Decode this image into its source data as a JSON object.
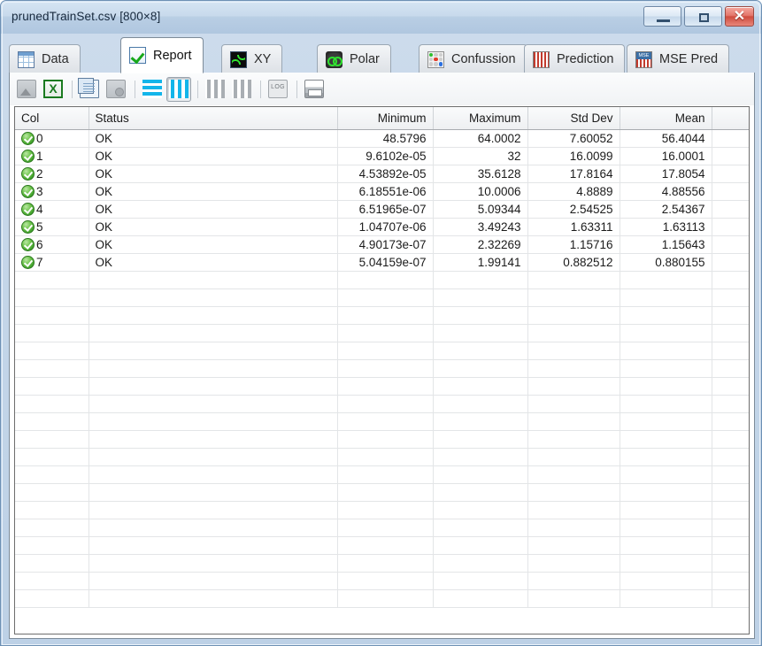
{
  "window": {
    "title": "prunedTrainSet.csv [800×8]",
    "controls": {
      "minimize": "Minimize",
      "maximize": "Maximize",
      "close": "✕"
    }
  },
  "tabs": [
    {
      "label": "Data",
      "icon": "table-grid-icon",
      "active": false
    },
    {
      "label": "Report",
      "icon": "checkbox-check-icon",
      "active": true
    },
    {
      "label": "XY",
      "icon": "sine-wave-icon",
      "active": false
    },
    {
      "label": "Polar",
      "icon": "polar-plot-icon",
      "active": false
    },
    {
      "label": "Confussion",
      "icon": "confusion-matrix-icon",
      "active": false
    },
    {
      "label": "Prediction",
      "icon": "prediction-grid-icon",
      "active": false
    },
    {
      "label": "MSE Pred",
      "icon": "mse-grid-icon",
      "active": false
    }
  ],
  "toolbar": {
    "buttons": [
      {
        "name": "save-image-button",
        "icon": "image-icon",
        "state": "disabled"
      },
      {
        "name": "export-excel-button",
        "icon": "excel-icon",
        "state": "enabled"
      },
      {
        "name": "copy-button",
        "icon": "copy-icon",
        "state": "enabled"
      },
      {
        "name": "paste-add-button",
        "icon": "paste-add-icon",
        "state": "disabled"
      },
      {
        "name": "horizontal-bars-button",
        "icon": "horizontal-bars-icon",
        "state": "enabled"
      },
      {
        "name": "vertical-bars-button",
        "icon": "vertical-bars-icon",
        "state": "pressed"
      },
      {
        "name": "gray-bars-1-button",
        "icon": "bars-icon",
        "state": "disabled"
      },
      {
        "name": "gray-bars-2-button",
        "icon": "bars-icon",
        "state": "disabled"
      },
      {
        "name": "log-scale-button",
        "icon": "log-icon",
        "state": "disabled"
      },
      {
        "name": "print-button",
        "icon": "printer-icon",
        "state": "enabled"
      }
    ]
  },
  "table": {
    "columns": [
      {
        "key": "col",
        "label": "Col",
        "align": "left"
      },
      {
        "key": "status",
        "label": "Status",
        "align": "left"
      },
      {
        "key": "minimum",
        "label": "Minimum",
        "align": "right"
      },
      {
        "key": "maximum",
        "label": "Maximum",
        "align": "right"
      },
      {
        "key": "stddev",
        "label": "Std Dev",
        "align": "right"
      },
      {
        "key": "mean",
        "label": "Mean",
        "align": "right"
      }
    ],
    "rows": [
      {
        "col": "0",
        "status": "OK",
        "minimum": "48.5796",
        "maximum": "64.0002",
        "stddev": "7.60052",
        "mean": "56.4044"
      },
      {
        "col": "1",
        "status": "OK",
        "minimum": "9.6102e-05",
        "maximum": "32",
        "stddev": "16.0099",
        "mean": "16.0001"
      },
      {
        "col": "2",
        "status": "OK",
        "minimum": "4.53892e-05",
        "maximum": "35.6128",
        "stddev": "17.8164",
        "mean": "17.8054"
      },
      {
        "col": "3",
        "status": "OK",
        "minimum": "6.18551e-06",
        "maximum": "10.0006",
        "stddev": "4.8889",
        "mean": "4.88556"
      },
      {
        "col": "4",
        "status": "OK",
        "minimum": "6.51965e-07",
        "maximum": "5.09344",
        "stddev": "2.54525",
        "mean": "2.54367"
      },
      {
        "col": "5",
        "status": "OK",
        "minimum": "1.04707e-06",
        "maximum": "3.49243",
        "stddev": "1.63311",
        "mean": "1.63113"
      },
      {
        "col": "6",
        "status": "OK",
        "minimum": "4.90173e-07",
        "maximum": "2.32269",
        "stddev": "1.15716",
        "mean": "1.15643"
      },
      {
        "col": "7",
        "status": "OK",
        "minimum": "5.04159e-07",
        "maximum": "1.99141",
        "stddev": "0.882512",
        "mean": "0.880155"
      }
    ],
    "empty_row_count": 19,
    "status_icon": "green-check-icon"
  },
  "colors": {
    "title_bar": "#c3d5e8",
    "accent_blue": "#13b5ea",
    "status_green": "#3d9e2a",
    "close_red": "#cf4c3e",
    "panel_bg": "#ffffff"
  }
}
